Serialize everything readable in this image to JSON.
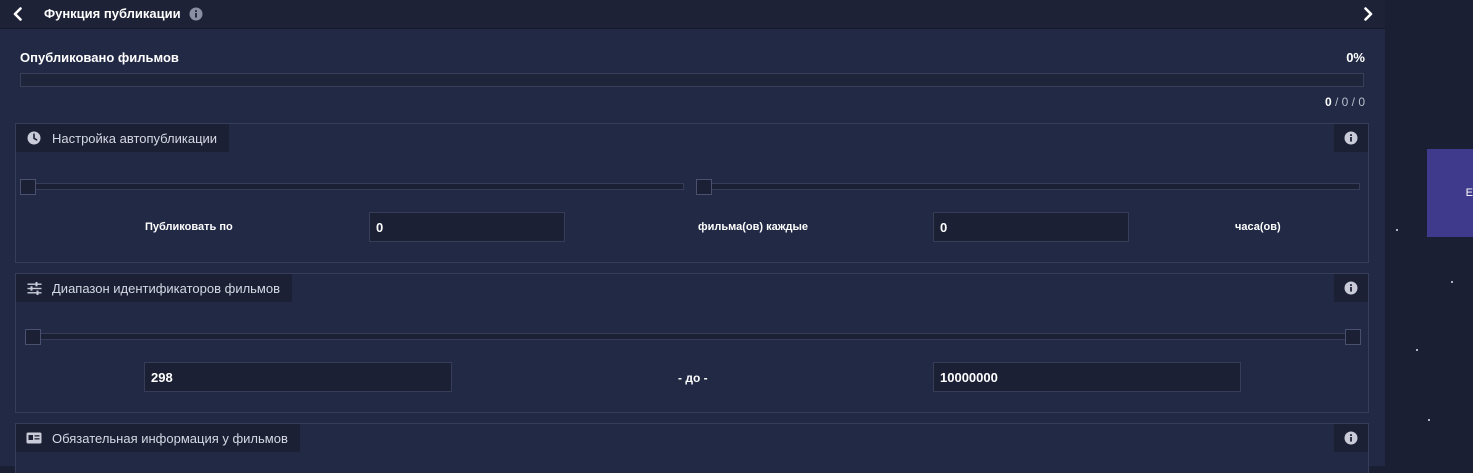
{
  "header": {
    "title": "Функция публикации",
    "prev_icon": "chevron-left-icon",
    "next_icon": "chevron-right-icon",
    "info_icon": "info-icon"
  },
  "progress": {
    "label": "Опубликовано фильмов",
    "percent_text": "0%",
    "fill_fraction": 0,
    "count_published": "0",
    "count_rest": " / 0 / 0",
    "fill_color": "#4c4496"
  },
  "autopublish": {
    "title": "Настройка автопубликации",
    "icon": "clock-icon",
    "publish_label": "Публиковать по",
    "films_value": "0",
    "films_every_label": "фильма(ов) каждые",
    "hours_value": "0",
    "hours_label": "часа(ов)"
  },
  "id_range": {
    "title": "Диапазон идентификаторов фильмов",
    "icon": "sliders-icon",
    "from_value": "298",
    "to_label": "- до -",
    "to_value": "10000000"
  },
  "required_info": {
    "title": "Обязательная информация у фильмов",
    "icon": "id-card-icon"
  },
  "side_button": {
    "label": "Е",
    "color": "#3f3a8c"
  },
  "colors": {
    "background": "#1b1f33",
    "panel": "#222944",
    "section_head": "#1b2034",
    "border": "#363d58"
  }
}
